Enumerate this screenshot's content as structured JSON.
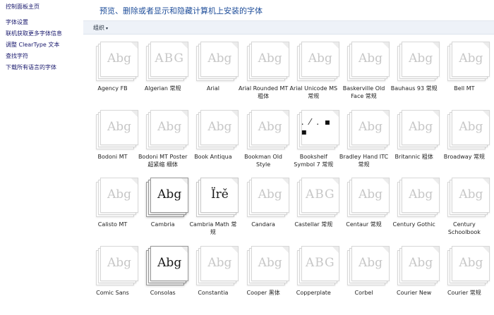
{
  "sidebar": {
    "home": "控制面板主页",
    "links": [
      "字体设置",
      "联机获取更多字体信息",
      "调整 ClearType 文本",
      "查找字符",
      "下载所有语言的字体"
    ]
  },
  "header": {
    "title": "预览、删除或者显示和隐藏计算机上安装的字体"
  },
  "toolbar": {
    "organize_label": "组织",
    "caret": "▾"
  },
  "fonts": [
    {
      "sample": "Abg",
      "label": "Agency FB"
    },
    {
      "sample": "ABG",
      "label": "Algerian 常规"
    },
    {
      "sample": "Abg",
      "label": "Arial"
    },
    {
      "sample": "Abg",
      "label": "Arial Rounded MT 粗体"
    },
    {
      "sample": "Abg",
      "label": "Arial Unicode MS 常规"
    },
    {
      "sample": "Abg",
      "label": "Baskerville Old Face 常规"
    },
    {
      "sample": "Abg",
      "label": "Bauhaus 93 常规"
    },
    {
      "sample": "Abg",
      "label": "Bell MT"
    },
    {
      "sample": "Abg",
      "label": "Bodoni MT"
    },
    {
      "sample": "Abg",
      "label": "Bodoni MT Poster 超紧缩 细体"
    },
    {
      "sample": "Abg",
      "label": "Book Antiqua"
    },
    {
      "sample": "Abg",
      "label": "Bookman Old Style"
    },
    {
      "sample": ". ⁄ .  ▪  ▪",
      "label": "Bookshelf Symbol 7 常规"
    },
    {
      "sample": "Abg",
      "label": "Bradley Hand ITC 常规"
    },
    {
      "sample": "Abg",
      "label": "Britannic 粗体"
    },
    {
      "sample": "Abg",
      "label": "Broadway 常规"
    },
    {
      "sample": "Abg",
      "label": "Calisto MT"
    },
    {
      "sample": "Abg",
      "label": "Cambria"
    },
    {
      "sample": "Ïrě",
      "label": "Cambria Math 常规"
    },
    {
      "sample": "Abg",
      "label": "Candara"
    },
    {
      "sample": "ABG",
      "label": "Castellar 常规"
    },
    {
      "sample": "Abg",
      "label": "Centaur 常规"
    },
    {
      "sample": "Abg",
      "label": "Century Gothic"
    },
    {
      "sample": "Abg",
      "label": "Century Schoolbook"
    },
    {
      "sample": "Abg",
      "label": "Comic Sans"
    },
    {
      "sample": "Abg",
      "label": "Consolas"
    },
    {
      "sample": "Abg",
      "label": "Constantia"
    },
    {
      "sample": "Abg",
      "label": "Cooper 黑体"
    },
    {
      "sample": "ABG",
      "label": "Copperplate"
    },
    {
      "sample": "Abg",
      "label": "Corbel"
    },
    {
      "sample": "Abg",
      "label": "Courier New"
    },
    {
      "sample": "Abg",
      "label": "Courier 常规"
    }
  ]
}
